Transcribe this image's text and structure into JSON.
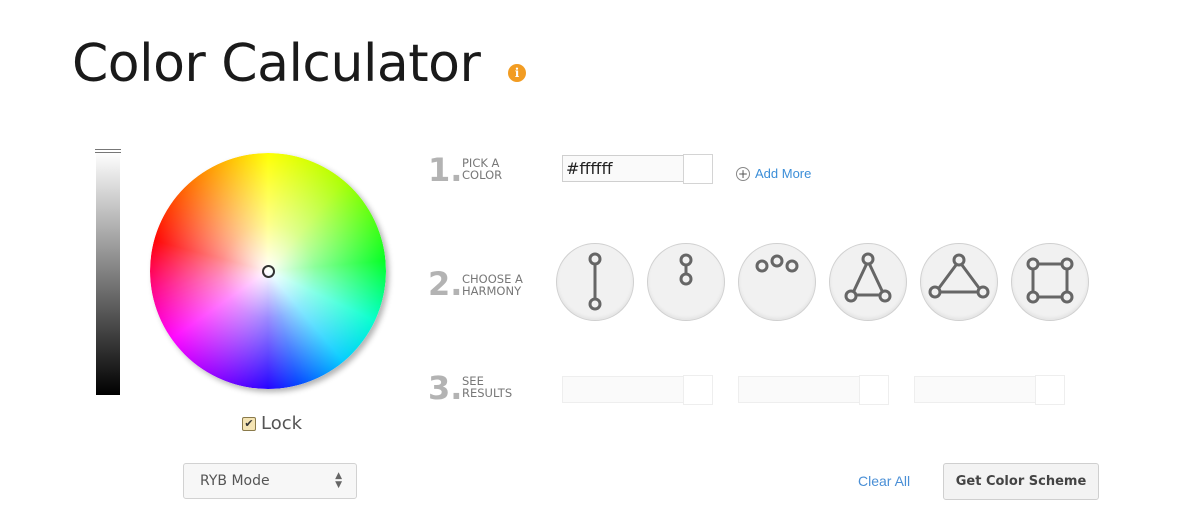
{
  "header": {
    "title": "Color Calculator",
    "info_icon": "info-icon",
    "info_glyph": "i"
  },
  "colors": {
    "accent_orange": "#f29c22",
    "link_blue": "#3b8ed8",
    "step_gray": "#b3b3b3"
  },
  "picker": {
    "lock_label": "Lock",
    "lock_checked": true,
    "lock_glyph": "✔",
    "mode_select": {
      "selected": "RYB Mode",
      "arrows": "▲▼"
    }
  },
  "steps": [
    {
      "number": "1.",
      "label_line1": "PICK A",
      "label_line2": "COLOR"
    },
    {
      "number": "2.",
      "label_line1": "CHOOSE A",
      "label_line2": "HARMONY"
    },
    {
      "number": "3.",
      "label_line1": "SEE",
      "label_line2": "RESULTS"
    }
  ],
  "pick": {
    "hex_value": "#ffffff",
    "add_more_label": "Add More",
    "add_glyph": "+"
  },
  "harmonies": [
    {
      "name": "complementary",
      "icon": "complementary-icon"
    },
    {
      "name": "split",
      "icon": "split-icon"
    },
    {
      "name": "analogous",
      "icon": "analogous-icon"
    },
    {
      "name": "triad",
      "icon": "triad-icon"
    },
    {
      "name": "triad-wide",
      "icon": "triad-wide-icon"
    },
    {
      "name": "square",
      "icon": "square-icon"
    }
  ],
  "actions": {
    "clear_all": "Clear All",
    "get_scheme": "Get Color Scheme"
  }
}
